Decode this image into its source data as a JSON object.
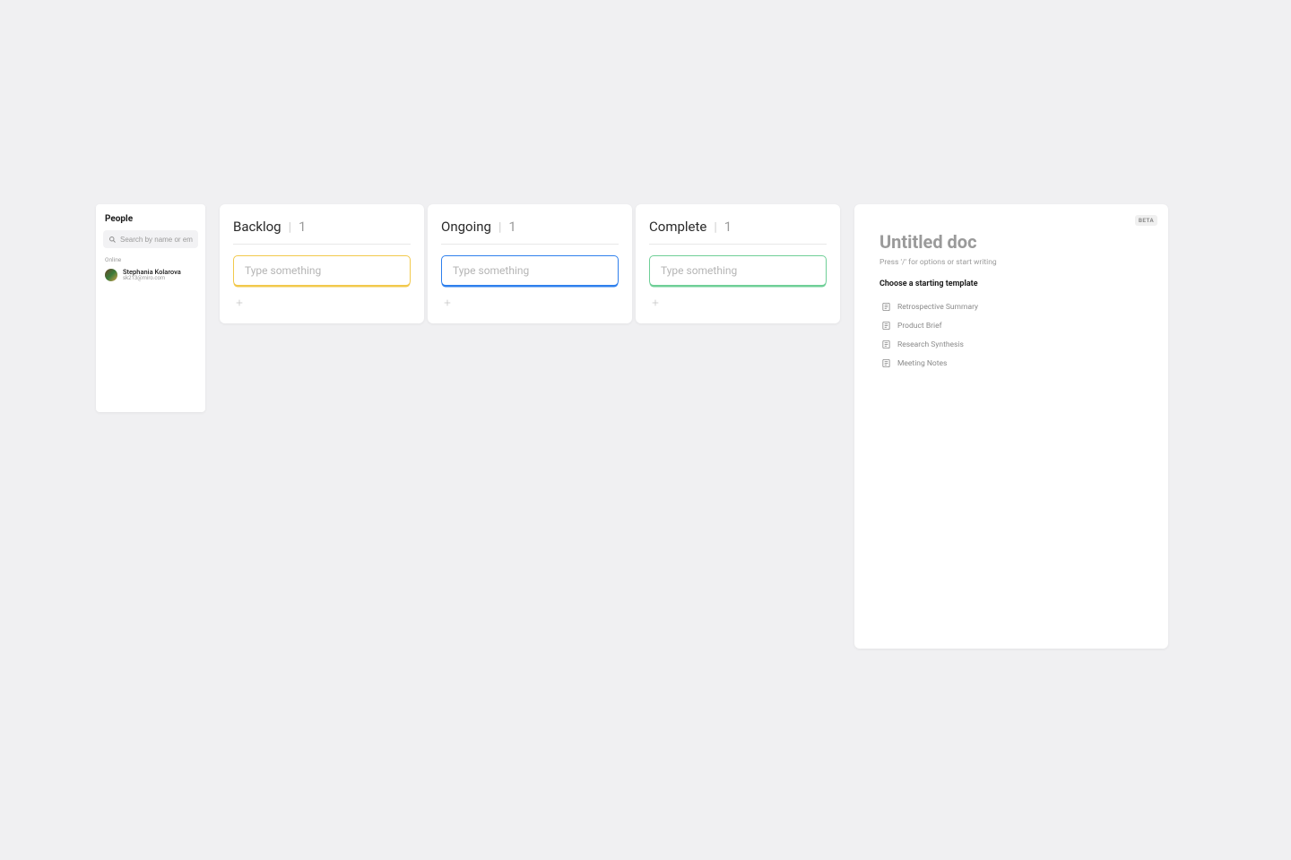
{
  "people": {
    "title": "People",
    "search_placeholder": "Search by name or email",
    "section_label": "Online",
    "items": [
      {
        "name": "Stephania Kolarova",
        "email": "sk213@miro.com"
      }
    ]
  },
  "columns": [
    {
      "title": "Backlog",
      "count": "1",
      "card_placeholder": "Type something",
      "color": "yellow"
    },
    {
      "title": "Ongoing",
      "count": "1",
      "card_placeholder": "Type something",
      "color": "blue"
    },
    {
      "title": "Complete",
      "count": "1",
      "card_placeholder": "Type something",
      "color": "green"
    }
  ],
  "doc": {
    "beta_label": "BETA",
    "title": "Untitled doc",
    "hint": "Press '/' for options or start writing",
    "choose_label": "Choose a starting template",
    "templates": [
      "Retrospective Summary",
      "Product Brief",
      "Research Synthesis",
      "Meeting Notes"
    ]
  }
}
